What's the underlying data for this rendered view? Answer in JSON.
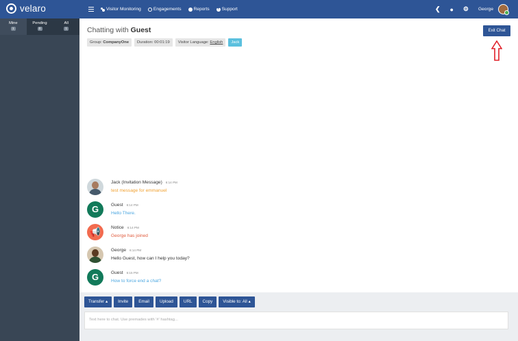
{
  "header": {
    "brand": "velaro",
    "nav": [
      {
        "label": "Visitor Monitoring",
        "icon": "people-icon"
      },
      {
        "label": "Engagements",
        "icon": "chat-bubble-icon"
      },
      {
        "label": "Reports",
        "icon": "pie-chart-icon"
      },
      {
        "label": "Support",
        "icon": "plus-circle-icon"
      }
    ],
    "right_icons": [
      "chevron-left-icon",
      "users-icon",
      "gear-icon"
    ],
    "user_name": "George",
    "colors": {
      "bar": "#2e5596"
    }
  },
  "sidebar": {
    "tabs": [
      {
        "label": "Mine",
        "count": "1"
      },
      {
        "label": "Pending",
        "count": "0"
      },
      {
        "label": "All",
        "count": "1"
      }
    ]
  },
  "chat": {
    "title_prefix": "Chatting with",
    "title_name": "Guest",
    "group_label": "Group:",
    "group_value": "CompanyOne",
    "duration": "Duration: 00:01:19",
    "language_label": "Visitor Language:",
    "language_value": "English",
    "agent_tag": "Jack",
    "exit_label": "Exit Chat"
  },
  "messages": [
    {
      "name": "Jack (Invitation Message)",
      "time": "6:14 PM",
      "text": "test message for emmanuel",
      "avatar": "photo"
    },
    {
      "name": "Guest",
      "time": "6:14 PM",
      "text": "Hello There.",
      "avatar": "G"
    },
    {
      "name": "Notice",
      "time": "6:14 PM",
      "text": "George has joined",
      "avatar": "megaphone"
    },
    {
      "name": "George",
      "time": "6:14 PM",
      "text": "Hello Guest, how can I help you today?",
      "avatar": "photo"
    },
    {
      "name": "Guest",
      "time": "6:15 PM",
      "text": "How to force end a chat?",
      "avatar": "G"
    }
  ],
  "toolbar": {
    "transfer": "Transfer ▴",
    "invite": "Invite",
    "email": "Email",
    "upload": "Upload",
    "url": "URL",
    "copy": "Copy",
    "visible": "Visible to: All ▴"
  },
  "compose": {
    "placeholder": "Text here to chat. Use premades with '#' hashtag..."
  }
}
